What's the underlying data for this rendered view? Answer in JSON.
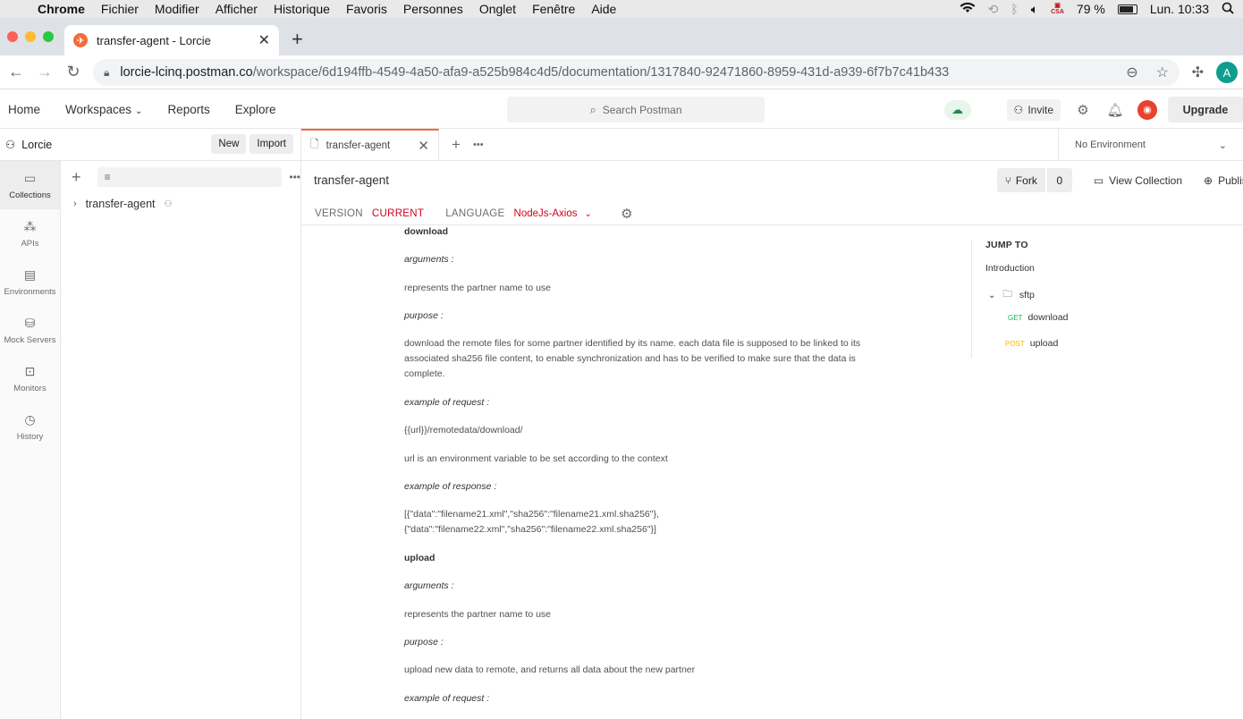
{
  "mac": {
    "app": "Chrome",
    "menus": [
      "Fichier",
      "Modifier",
      "Afficher",
      "Historique",
      "Favoris",
      "Personnes",
      "Onglet",
      "Fenêtre",
      "Aide"
    ],
    "battery": "79 %",
    "clock": "Lun. 10:33",
    "csa_label": "CSA"
  },
  "browser": {
    "tab_title": "transfer-agent - Lorcie",
    "url_host": "lorcie-lcinq.postman.co",
    "url_path": "/workspace/6d194ffb-4549-4a50-afa9-a525b984c4d5/documentation/1317840-92471860-8959-431d-a939-6f7b7c41b433",
    "profile_initial": "A"
  },
  "header": {
    "nav": [
      "Home",
      "Workspaces",
      "Reports",
      "Explore"
    ],
    "search_placeholder": "Search Postman",
    "invite": "Invite",
    "upgrade": "Upgrade"
  },
  "workspace": {
    "name": "Lorcie",
    "new": "New",
    "import": "Import"
  },
  "sidebar": {
    "items": [
      {
        "label": "Collections",
        "icon": "collections-icon"
      },
      {
        "label": "APIs",
        "icon": "apis-icon"
      },
      {
        "label": "Environments",
        "icon": "environments-icon"
      },
      {
        "label": "Mock Servers",
        "icon": "mock-servers-icon"
      },
      {
        "label": "Monitors",
        "icon": "monitors-icon"
      },
      {
        "label": "History",
        "icon": "history-icon"
      }
    ]
  },
  "collections": {
    "items": [
      "transfer-agent"
    ]
  },
  "tabs": {
    "active": "transfer-agent",
    "environment": "No Environment"
  },
  "doc": {
    "title": "transfer-agent",
    "fork": "Fork",
    "fork_count": "0",
    "view_collection": "View Collection",
    "publish": "Publish",
    "version_label": "VERSION",
    "version_value": "CURRENT",
    "language_label": "LANGUAGE",
    "language_value": "NodeJs-Axios",
    "body": [
      {
        "style": "h",
        "text": "download"
      },
      {
        "style": "it",
        "text": "arguments :"
      },
      {
        "style": "p",
        "text": "represents the partner name to use"
      },
      {
        "style": "it",
        "text": "purpose :"
      },
      {
        "style": "p",
        "text": "download the remote files for some partner identified by its name. each data file is supposed to be linked to its\nassociated sha256 file content, to enable synchronization and has to be verified to make sure that the data is\ncomplete."
      },
      {
        "style": "it",
        "text": "example of request :"
      },
      {
        "style": "p",
        "text": "{{url}}/remotedata/download/"
      },
      {
        "style": "p",
        "text": "url is an environment variable to be set according to the context"
      },
      {
        "style": "it",
        "text": "example of response :"
      },
      {
        "style": "p",
        "text": "[{\"data\":\"filename21.xml\",\"sha256\":\"filename21.xml.sha256\"},\n{\"data\":\"filename22.xml\",\"sha256\":\"filename22.xml.sha256\"}]"
      },
      {
        "style": "h",
        "text": "upload"
      },
      {
        "style": "it",
        "text": "arguments :"
      },
      {
        "style": "p",
        "text": "represents the partner name to use"
      },
      {
        "style": "it",
        "text": "purpose :"
      },
      {
        "style": "p",
        "text": "upload new data to remote, and returns all data about the new partner"
      },
      {
        "style": "it",
        "text": "example of request :"
      }
    ]
  },
  "jump_to": {
    "title": "JUMP TO",
    "intro": "Introduction",
    "folder": "sftp",
    "requests": [
      {
        "method": "GET",
        "name": "download"
      },
      {
        "method": "POST",
        "name": "upload"
      }
    ]
  },
  "colors": {
    "accent": "#f26b3a",
    "current": "#d0021b",
    "get": "#0cbb52",
    "post": "#ffb400"
  }
}
